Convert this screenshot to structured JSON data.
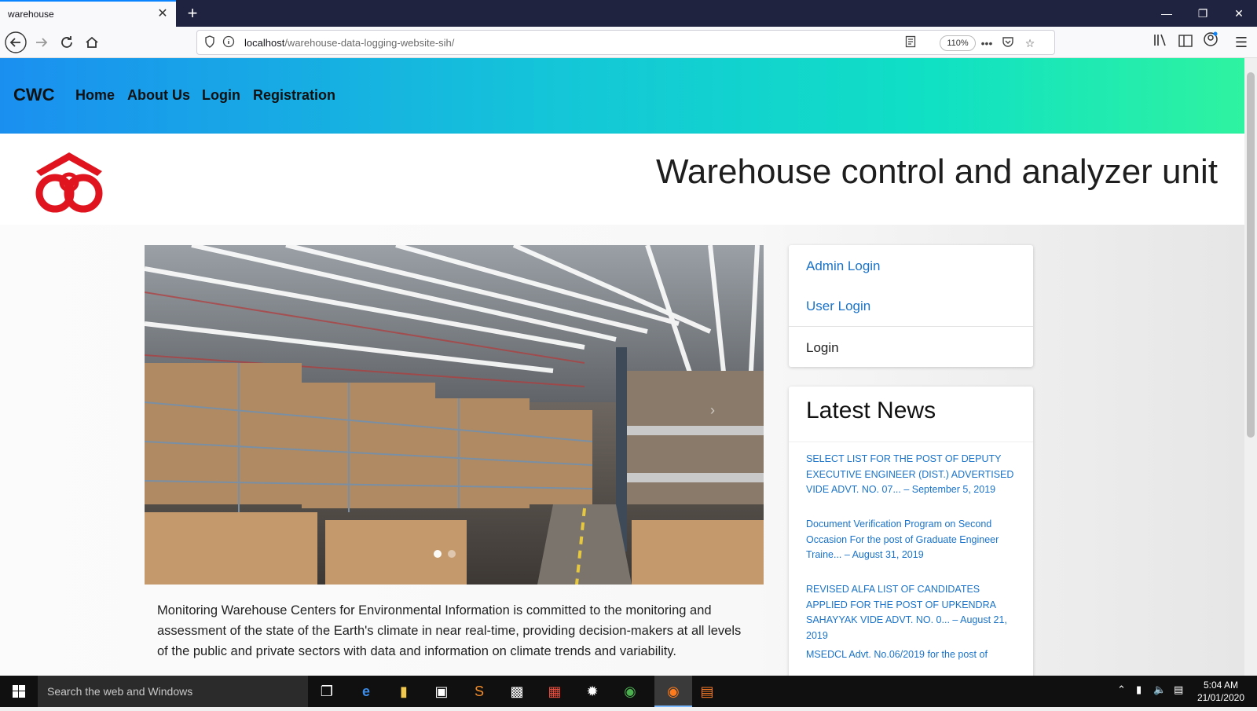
{
  "browser": {
    "tab_title": "warehouse",
    "tab_close": "✕",
    "new_tab": "+",
    "url_host": "localhost",
    "url_path": "/warehouse-data-logging-website-sih/",
    "zoom": "110%"
  },
  "site": {
    "brand": "CWC",
    "menu": [
      "Home",
      "About Us",
      "Login",
      "Registration"
    ],
    "title": "Warehouse control and analyzer unit",
    "intro": "Monitoring Warehouse Centers for Environmental Information is committed to the monitoring and assessment of the state of the Earth's climate in near real-time, providing decision-makers at all levels of the public and private sectors with data and information on climate trends and variability."
  },
  "login_card": {
    "admin_login": "Admin Login",
    "user_login": "User Login",
    "login": "Login"
  },
  "news": {
    "title": "Latest News",
    "items": [
      "SELECT LIST FOR THE POST OF DEPUTY EXECUTIVE ENGINEER (DIST.) ADVERTISED VIDE ADVT. NO. 07... – September 5, 2019",
      "Document Verification Program on Second Occasion For the post of Graduate Engineer Traine... – August 31, 2019",
      "REVISED ALFA LIST OF CANDIDATES APPLIED FOR THE POST OF UPKENDRA SAHAYYAK VIDE ADVT. NO. 0... – August 21, 2019",
      "MSEDCL Advt. No.06/2019 for the post of"
    ]
  },
  "taskbar": {
    "search_placeholder": "Search the web and Windows",
    "time": "5:04 AM",
    "date": "21/01/2020"
  },
  "colors": {
    "link": "#1a73c9",
    "nav_gradient_start": "#1a8ff0",
    "nav_gradient_end": "#2ef3a0",
    "logo_red": "#e0141e"
  }
}
